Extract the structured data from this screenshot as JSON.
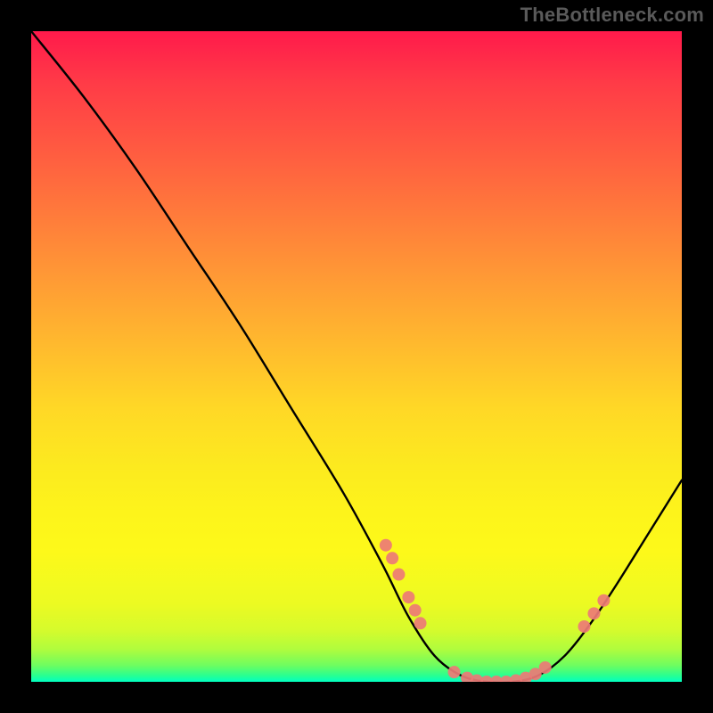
{
  "attribution": "TheBottleneck.com",
  "chart_data": {
    "type": "line",
    "title": "",
    "xlabel": "",
    "ylabel": "",
    "xlim": [
      0,
      100
    ],
    "ylim": [
      0,
      100
    ],
    "background_gradient": {
      "top": "#ff1a4b",
      "upper_mid": "#ff9a35",
      "mid": "#fdf41b",
      "lower": "#6dfd60",
      "bottom": "#00ffc2"
    },
    "series": [
      {
        "name": "bottleneck-curve",
        "color": "#000000",
        "points": [
          {
            "x": 0,
            "y": 100
          },
          {
            "x": 8,
            "y": 90
          },
          {
            "x": 16,
            "y": 79
          },
          {
            "x": 24,
            "y": 67
          },
          {
            "x": 32,
            "y": 55
          },
          {
            "x": 40,
            "y": 42
          },
          {
            "x": 48,
            "y": 29
          },
          {
            "x": 54,
            "y": 18
          },
          {
            "x": 58,
            "y": 10
          },
          {
            "x": 62,
            "y": 4
          },
          {
            "x": 66,
            "y": 1
          },
          {
            "x": 70,
            "y": 0
          },
          {
            "x": 74,
            "y": 0
          },
          {
            "x": 78,
            "y": 1
          },
          {
            "x": 82,
            "y": 4
          },
          {
            "x": 86,
            "y": 9
          },
          {
            "x": 90,
            "y": 15
          },
          {
            "x": 95,
            "y": 23
          },
          {
            "x": 100,
            "y": 31
          }
        ]
      }
    ],
    "markers": {
      "name": "highlighted-points",
      "color": "#ed7a76",
      "points": [
        {
          "x": 54.5,
          "y": 21
        },
        {
          "x": 55.5,
          "y": 19
        },
        {
          "x": 56.5,
          "y": 16.5
        },
        {
          "x": 58.0,
          "y": 13
        },
        {
          "x": 59.0,
          "y": 11
        },
        {
          "x": 59.8,
          "y": 9
        },
        {
          "x": 65.0,
          "y": 1.5
        },
        {
          "x": 67.0,
          "y": 0.6
        },
        {
          "x": 68.5,
          "y": 0.2
        },
        {
          "x": 70.0,
          "y": 0
        },
        {
          "x": 71.5,
          "y": 0
        },
        {
          "x": 73.0,
          "y": 0
        },
        {
          "x": 74.5,
          "y": 0.2
        },
        {
          "x": 76.0,
          "y": 0.6
        },
        {
          "x": 77.5,
          "y": 1.2
        },
        {
          "x": 79.0,
          "y": 2.2
        },
        {
          "x": 85.0,
          "y": 8.5
        },
        {
          "x": 86.5,
          "y": 10.5
        },
        {
          "x": 88.0,
          "y": 12.5
        }
      ]
    }
  }
}
